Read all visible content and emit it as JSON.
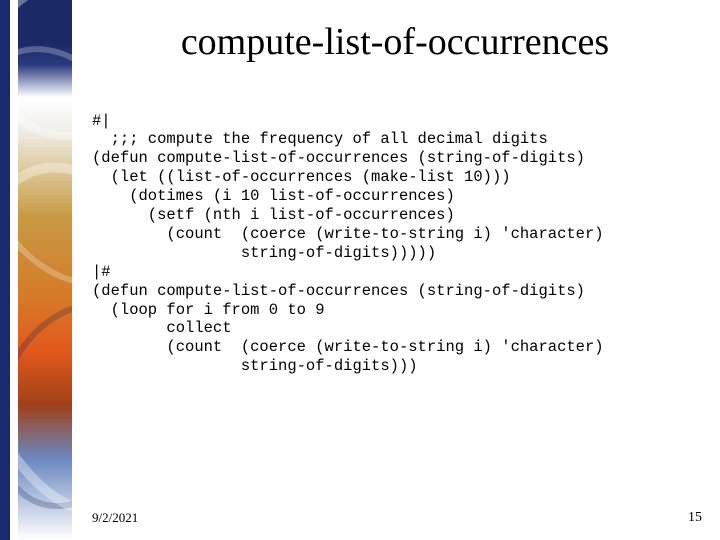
{
  "title": "compute-list-of-occurrences",
  "code_lines": [
    "#|",
    "  ;;; compute the frequency of all decimal digits",
    "(defun compute-list-of-occurrences (string-of-digits)",
    "  (let ((list-of-occurrences (make-list 10)))",
    "    (dotimes (i 10 list-of-occurrences)",
    "      (setf (nth i list-of-occurrences)",
    "        (count  (coerce (write-to-string i) 'character)",
    "                string-of-digits)))))",
    "|#",
    "(defun compute-list-of-occurrences (string-of-digits)",
    "  (loop for i from 0 to 9",
    "        collect",
    "        (count  (coerce (write-to-string i) 'character)",
    "                string-of-digits)))"
  ],
  "footer": {
    "date": "9/2/2021",
    "page": "15"
  }
}
